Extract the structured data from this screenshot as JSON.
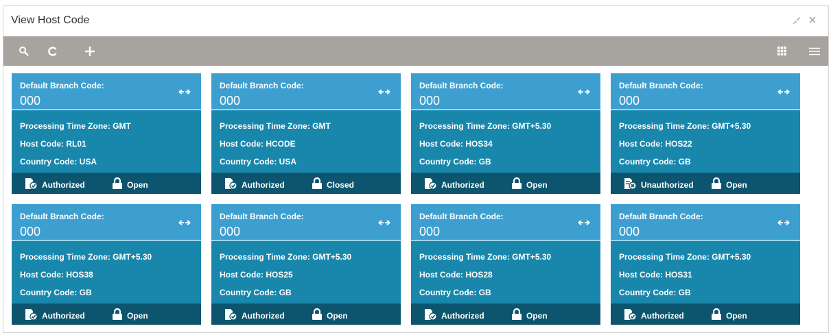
{
  "window": {
    "title": "View Host Code"
  },
  "colors": {
    "toolbar": "#a7a39e",
    "card_header": "#3d9fd0",
    "card_body": "#1987ac",
    "card_footer": "#0d556e"
  },
  "icons": [
    "search-icon",
    "refresh-icon",
    "add-icon",
    "tile-view-icon",
    "list-view-icon",
    "minimize-icon",
    "close-icon",
    "sync-icon",
    "authorized-icon",
    "unauthorized-icon",
    "lock-icon"
  ],
  "cards": [
    {
      "dbc_label": "Default Branch Code:",
      "dbc": "000",
      "tz": "Processing Time Zone: GMT",
      "host": "Host Code: RL01",
      "country": "Country Code: USA",
      "auth": "Authorized",
      "lock": "Open"
    },
    {
      "dbc_label": "Default Branch Code:",
      "dbc": "000",
      "tz": "Processing Time Zone: GMT",
      "host": "Host Code: HCODE",
      "country": "Country Code: USA",
      "auth": "Authorized",
      "lock": "Closed"
    },
    {
      "dbc_label": "Default Branch Code:",
      "dbc": "000",
      "tz": "Processing Time Zone: GMT+5.30",
      "host": "Host Code: HOS34",
      "country": "Country Code: GB",
      "auth": "Authorized",
      "lock": "Open"
    },
    {
      "dbc_label": "Default Branch Code:",
      "dbc": "000",
      "tz": "Processing Time Zone: GMT+5.30",
      "host": "Host Code: HOS22",
      "country": "Country Code: GB",
      "auth": "Unauthorized",
      "lock": "Open"
    },
    {
      "dbc_label": "Default Branch Code:",
      "dbc": "000",
      "tz": "Processing Time Zone: GMT+5.30",
      "host": "Host Code: HOS38",
      "country": "Country Code: GB",
      "auth": "Authorized",
      "lock": "Open"
    },
    {
      "dbc_label": "Default Branch Code:",
      "dbc": "000",
      "tz": "Processing Time Zone: GMT+5.30",
      "host": "Host Code: HOS25",
      "country": "Country Code: GB",
      "auth": "Authorized",
      "lock": "Open"
    },
    {
      "dbc_label": "Default Branch Code:",
      "dbc": "000",
      "tz": "Processing Time Zone: GMT+5.30",
      "host": "Host Code: HOS28",
      "country": "Country Code: GB",
      "auth": "Authorized",
      "lock": "Open"
    },
    {
      "dbc_label": "Default Branch Code:",
      "dbc": "000",
      "tz": "Processing Time Zone: GMT+5.30",
      "host": "Host Code: HOS31",
      "country": "Country Code: GB",
      "auth": "Authorized",
      "lock": "Open"
    }
  ]
}
